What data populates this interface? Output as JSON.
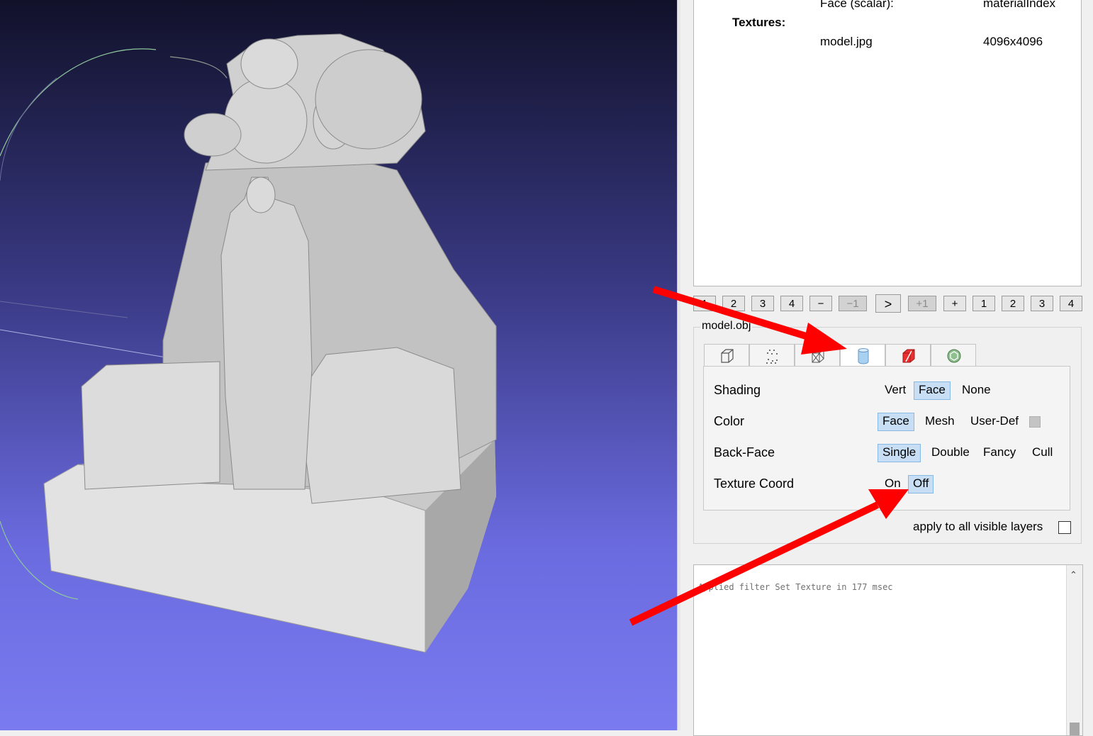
{
  "viewport": {
    "content": "3D mesh of a ram sphinx statue with standing figure"
  },
  "info": {
    "face_label": "Face (scalar):",
    "face_value": "materialIndex",
    "textures_label": "Textures:",
    "texture_file": "model.jpg",
    "texture_size": "4096x4096"
  },
  "nav": [
    "1",
    "2",
    "3",
    "4",
    "−",
    "−1",
    ">",
    "+1",
    "+",
    "1",
    "2",
    "3",
    "4"
  ],
  "layer": {
    "name": "model.obj",
    "tabs": [
      "box-icon",
      "points-icon",
      "wireframe-icon",
      "cylinder-icon",
      "red-box-icon",
      "texture-icon"
    ],
    "rows": [
      {
        "label": "Shading",
        "options": [
          "Vert",
          "Face",
          "None"
        ],
        "selected": "Face"
      },
      {
        "label": "Color",
        "options": [
          "Face",
          "Mesh",
          "User-Def"
        ],
        "selected": "Face"
      },
      {
        "label": "Back-Face",
        "options": [
          "Single",
          "Double",
          "Fancy",
          "Cull"
        ],
        "selected": "Single"
      },
      {
        "label": "Texture Coord",
        "options": [
          "On",
          "Off"
        ],
        "selected": "Off"
      }
    ],
    "apply_all": "apply to all visible layers"
  },
  "log": {
    "text": "Applied filter Set Texture in 177 msec"
  },
  "colors": {
    "selected_bg": "#c7def4",
    "arrow": "#ff0000"
  }
}
